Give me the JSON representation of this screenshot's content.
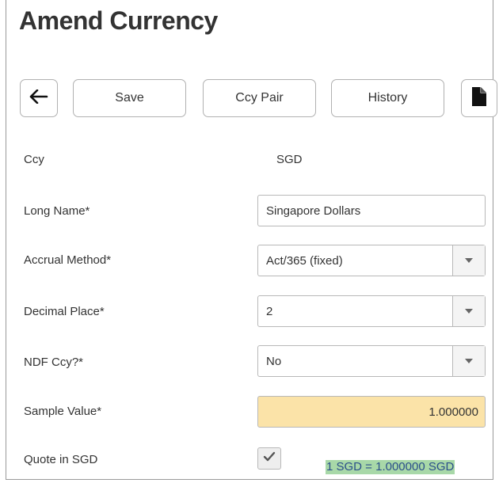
{
  "page": {
    "title": "Amend Currency"
  },
  "toolbar": {
    "back_icon": "arrow-left-icon",
    "save_label": "Save",
    "ccy_pair_label": "Ccy Pair",
    "history_label": "History",
    "doc_icon": "document-icon"
  },
  "form": {
    "ccy": {
      "label": "Ccy",
      "value": "SGD"
    },
    "long_name": {
      "label": "Long Name*",
      "value": "Singapore Dollars"
    },
    "accrual_method": {
      "label": "Accrual Method*",
      "value": "Act/365 (fixed)"
    },
    "decimal_place": {
      "label": "Decimal Place*",
      "value": "2"
    },
    "ndf_ccy": {
      "label": "NDF Ccy?*",
      "value": "No"
    },
    "sample_value": {
      "label": "Sample Value*",
      "value": "1.000000"
    },
    "quote_in_sgd": {
      "label": "Quote in SGD",
      "checked": true,
      "result": "1 SGD = 1.000000 SGD"
    }
  },
  "colors": {
    "sample_bg": "#fbe3a8",
    "result_highlight": "#a8d8a8",
    "result_text": "#2b4f8a"
  }
}
